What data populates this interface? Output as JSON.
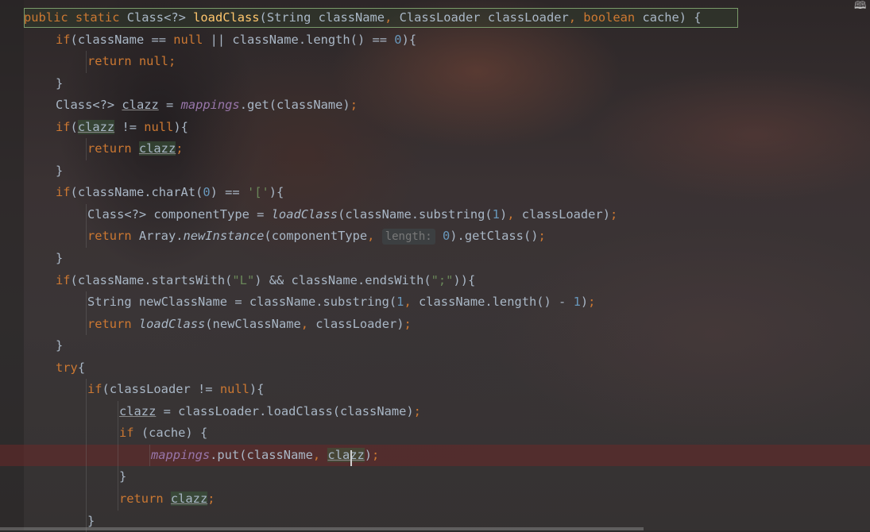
{
  "editor": {
    "language": "Java",
    "lines": [
      {
        "indent": 0,
        "highlight": true,
        "tokens": [
          {
            "t": "public static ",
            "c": "k"
          },
          {
            "t": "Class<?> "
          },
          {
            "t": "loadClass",
            "c": "f"
          },
          {
            "t": "(String className"
          },
          {
            "t": ", ",
            "c": "k"
          },
          {
            "t": "ClassLoader classLoader"
          },
          {
            "t": ", ",
            "c": "k"
          },
          {
            "t": "boolean ",
            "c": "k"
          },
          {
            "t": "cache) {"
          }
        ]
      },
      {
        "indent": 1,
        "tokens": [
          {
            "t": "if",
            "c": "k"
          },
          {
            "t": "(className == "
          },
          {
            "t": "null",
            "c": "k"
          },
          {
            "t": " || className.length() == "
          },
          {
            "t": "0",
            "c": "n"
          },
          {
            "t": "){"
          }
        ]
      },
      {
        "indent": 2,
        "tokens": [
          {
            "t": "return null",
            "c": "k"
          },
          {
            "t": ";",
            "c": "k"
          }
        ]
      },
      {
        "indent": 1,
        "tokens": [
          {
            "t": "}"
          }
        ]
      },
      {
        "indent": 1,
        "tokens": [
          {
            "t": "Class<?> "
          },
          {
            "t": "clazz",
            "c": "u"
          },
          {
            "t": " = "
          },
          {
            "t": "mappings",
            "c": "sf"
          },
          {
            "t": ".get(className)"
          },
          {
            "t": ";",
            "c": "k"
          }
        ]
      },
      {
        "indent": 1,
        "tokens": [
          {
            "t": "if",
            "c": "k"
          },
          {
            "t": "("
          },
          {
            "t": "clazz",
            "c": "u mark"
          },
          {
            "t": " != "
          },
          {
            "t": "null",
            "c": "k"
          },
          {
            "t": "){"
          }
        ]
      },
      {
        "indent": 2,
        "tokens": [
          {
            "t": "return ",
            "c": "k"
          },
          {
            "t": "clazz",
            "c": "u mark"
          },
          {
            "t": ";",
            "c": "k"
          }
        ]
      },
      {
        "indent": 1,
        "tokens": [
          {
            "t": "}"
          }
        ]
      },
      {
        "indent": 1,
        "tokens": [
          {
            "t": "if",
            "c": "k"
          },
          {
            "t": "(className.charAt("
          },
          {
            "t": "0",
            "c": "n"
          },
          {
            "t": ") == "
          },
          {
            "t": "'['",
            "c": "s"
          },
          {
            "t": "){"
          }
        ]
      },
      {
        "indent": 2,
        "tokens": [
          {
            "t": "Class<?> componentType = "
          },
          {
            "t": "loadClass",
            "c": "i"
          },
          {
            "t": "(className.substring("
          },
          {
            "t": "1",
            "c": "n"
          },
          {
            "t": ")"
          },
          {
            "t": ", ",
            "c": "k"
          },
          {
            "t": "classLoader)"
          },
          {
            "t": ";",
            "c": "k"
          }
        ]
      },
      {
        "indent": 2,
        "tokens": [
          {
            "t": "return ",
            "c": "k"
          },
          {
            "t": "Array."
          },
          {
            "t": "newInstance",
            "c": "i"
          },
          {
            "t": "(componentType"
          },
          {
            "t": ", ",
            "c": "k"
          },
          {
            "t": "length:",
            "c": "hint"
          },
          {
            "t": " "
          },
          {
            "t": "0",
            "c": "n"
          },
          {
            "t": ").getClass()"
          },
          {
            "t": ";",
            "c": "k"
          }
        ]
      },
      {
        "indent": 1,
        "tokens": [
          {
            "t": "}"
          }
        ]
      },
      {
        "indent": 1,
        "tokens": [
          {
            "t": "if",
            "c": "k"
          },
          {
            "t": "(className.startsWith("
          },
          {
            "t": "\"L\"",
            "c": "s"
          },
          {
            "t": ") && className.endsWith("
          },
          {
            "t": "\";\"",
            "c": "s"
          },
          {
            "t": ")){"
          }
        ]
      },
      {
        "indent": 2,
        "tokens": [
          {
            "t": "String newClassName = className.substring("
          },
          {
            "t": "1",
            "c": "n"
          },
          {
            "t": ", ",
            "c": "k"
          },
          {
            "t": "className.length() - "
          },
          {
            "t": "1",
            "c": "n"
          },
          {
            "t": ")"
          },
          {
            "t": ";",
            "c": "k"
          }
        ]
      },
      {
        "indent": 2,
        "tokens": [
          {
            "t": "return ",
            "c": "k"
          },
          {
            "t": "loadClass",
            "c": "i"
          },
          {
            "t": "(newClassName"
          },
          {
            "t": ", ",
            "c": "k"
          },
          {
            "t": "classLoader)"
          },
          {
            "t": ";",
            "c": "k"
          }
        ]
      },
      {
        "indent": 1,
        "tokens": [
          {
            "t": "}"
          }
        ]
      },
      {
        "indent": 1,
        "tokens": [
          {
            "t": "try",
            "c": "k"
          },
          {
            "t": "{"
          }
        ]
      },
      {
        "indent": 2,
        "tokens": [
          {
            "t": "if",
            "c": "k"
          },
          {
            "t": "(classLoader != "
          },
          {
            "t": "null",
            "c": "k"
          },
          {
            "t": "){"
          }
        ]
      },
      {
        "indent": 3,
        "tokens": [
          {
            "t": "clazz",
            "c": "u"
          },
          {
            "t": " = classLoader.loadClass(className)"
          },
          {
            "t": ";",
            "c": "k"
          }
        ]
      },
      {
        "indent": 3,
        "tokens": [
          {
            "t": "if ",
            "c": "k"
          },
          {
            "t": "(cache) {"
          }
        ]
      },
      {
        "indent": 4,
        "error": true,
        "tokens": [
          {
            "t": "mappings",
            "c": "sf"
          },
          {
            "t": ".put(className"
          },
          {
            "t": ", ",
            "c": "k"
          },
          {
            "t": "clazz",
            "c": "u mark caret"
          },
          {
            "t": ")"
          },
          {
            "t": ";",
            "c": "k"
          }
        ]
      },
      {
        "indent": 3,
        "tokens": [
          {
            "t": "}"
          }
        ]
      },
      {
        "indent": 3,
        "tokens": [
          {
            "t": "return ",
            "c": "k"
          },
          {
            "t": "clazz",
            "c": "u mark"
          },
          {
            "t": ";",
            "c": "k"
          }
        ]
      },
      {
        "indent": 2,
        "tokens": [
          {
            "t": "}"
          }
        ]
      }
    ]
  }
}
